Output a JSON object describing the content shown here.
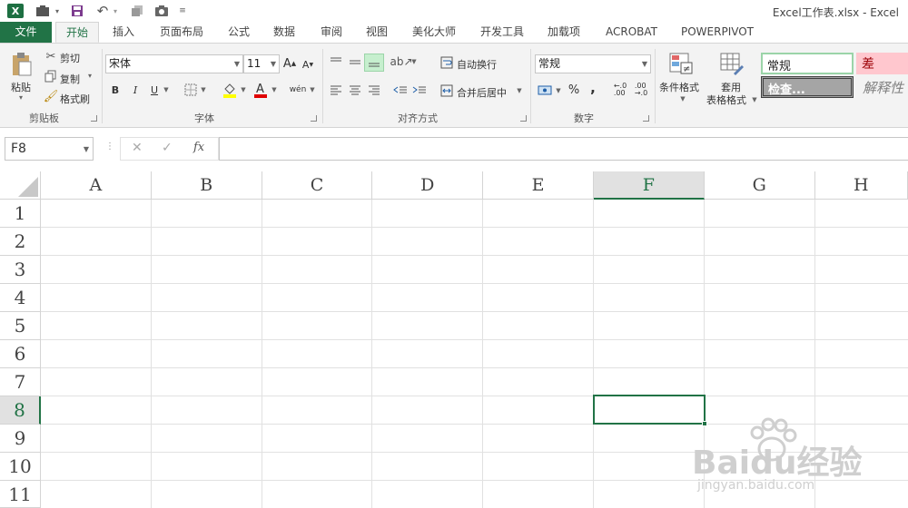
{
  "window": {
    "title": "Excel工作表.xlsx - Excel"
  },
  "quick_access": {
    "undo_icon": "undo-icon",
    "save_icon": "save-icon",
    "camera_icon": "camera-icon"
  },
  "tabs": [
    {
      "label": "文件"
    },
    {
      "label": "开始"
    },
    {
      "label": "插入"
    },
    {
      "label": "页面布局"
    },
    {
      "label": "公式"
    },
    {
      "label": "数据"
    },
    {
      "label": "审阅"
    },
    {
      "label": "视图"
    },
    {
      "label": "美化大师"
    },
    {
      "label": "开发工具"
    },
    {
      "label": "加载项"
    },
    {
      "label": "ACROBAT"
    },
    {
      "label": "POWERPIVOT"
    }
  ],
  "ribbon": {
    "clipboard": {
      "paste": "粘贴",
      "cut": "剪切",
      "copy": "复制",
      "format_painter": "格式刷",
      "label": "剪贴板"
    },
    "font": {
      "name": "宋体",
      "size": "11",
      "bold": "B",
      "italic": "I",
      "underline": "U",
      "label": "字体"
    },
    "alignment": {
      "wrap": "自动换行",
      "merge": "合并后居中",
      "label": "对齐方式"
    },
    "number": {
      "format": "常规",
      "percent": "%",
      "comma": ",",
      "label": "数字"
    },
    "styles": {
      "conditional": "条件格式",
      "table_line1": "套用",
      "table_line2": "表格格式",
      "normal": "常规",
      "bad": "差",
      "check": "检查...",
      "explanatory": "解释性"
    }
  },
  "formula_bar": {
    "name_box": "F8",
    "cancel": "✕",
    "enter": "✓",
    "fx": "fx",
    "value": ""
  },
  "grid": {
    "columns": [
      "A",
      "B",
      "C",
      "D",
      "E",
      "F",
      "G",
      "H"
    ],
    "rows": [
      "1",
      "2",
      "3",
      "4",
      "5",
      "6",
      "7",
      "8",
      "9",
      "10",
      "11"
    ],
    "selected_column": "F",
    "selected_row": "8"
  },
  "watermark": {
    "brand": "Baidu经验",
    "url": "jingyan.baidu.com"
  },
  "colors": {
    "accent": "#217346",
    "bad_fill": "#ffc7ce",
    "bad_text": "#9c0006"
  }
}
